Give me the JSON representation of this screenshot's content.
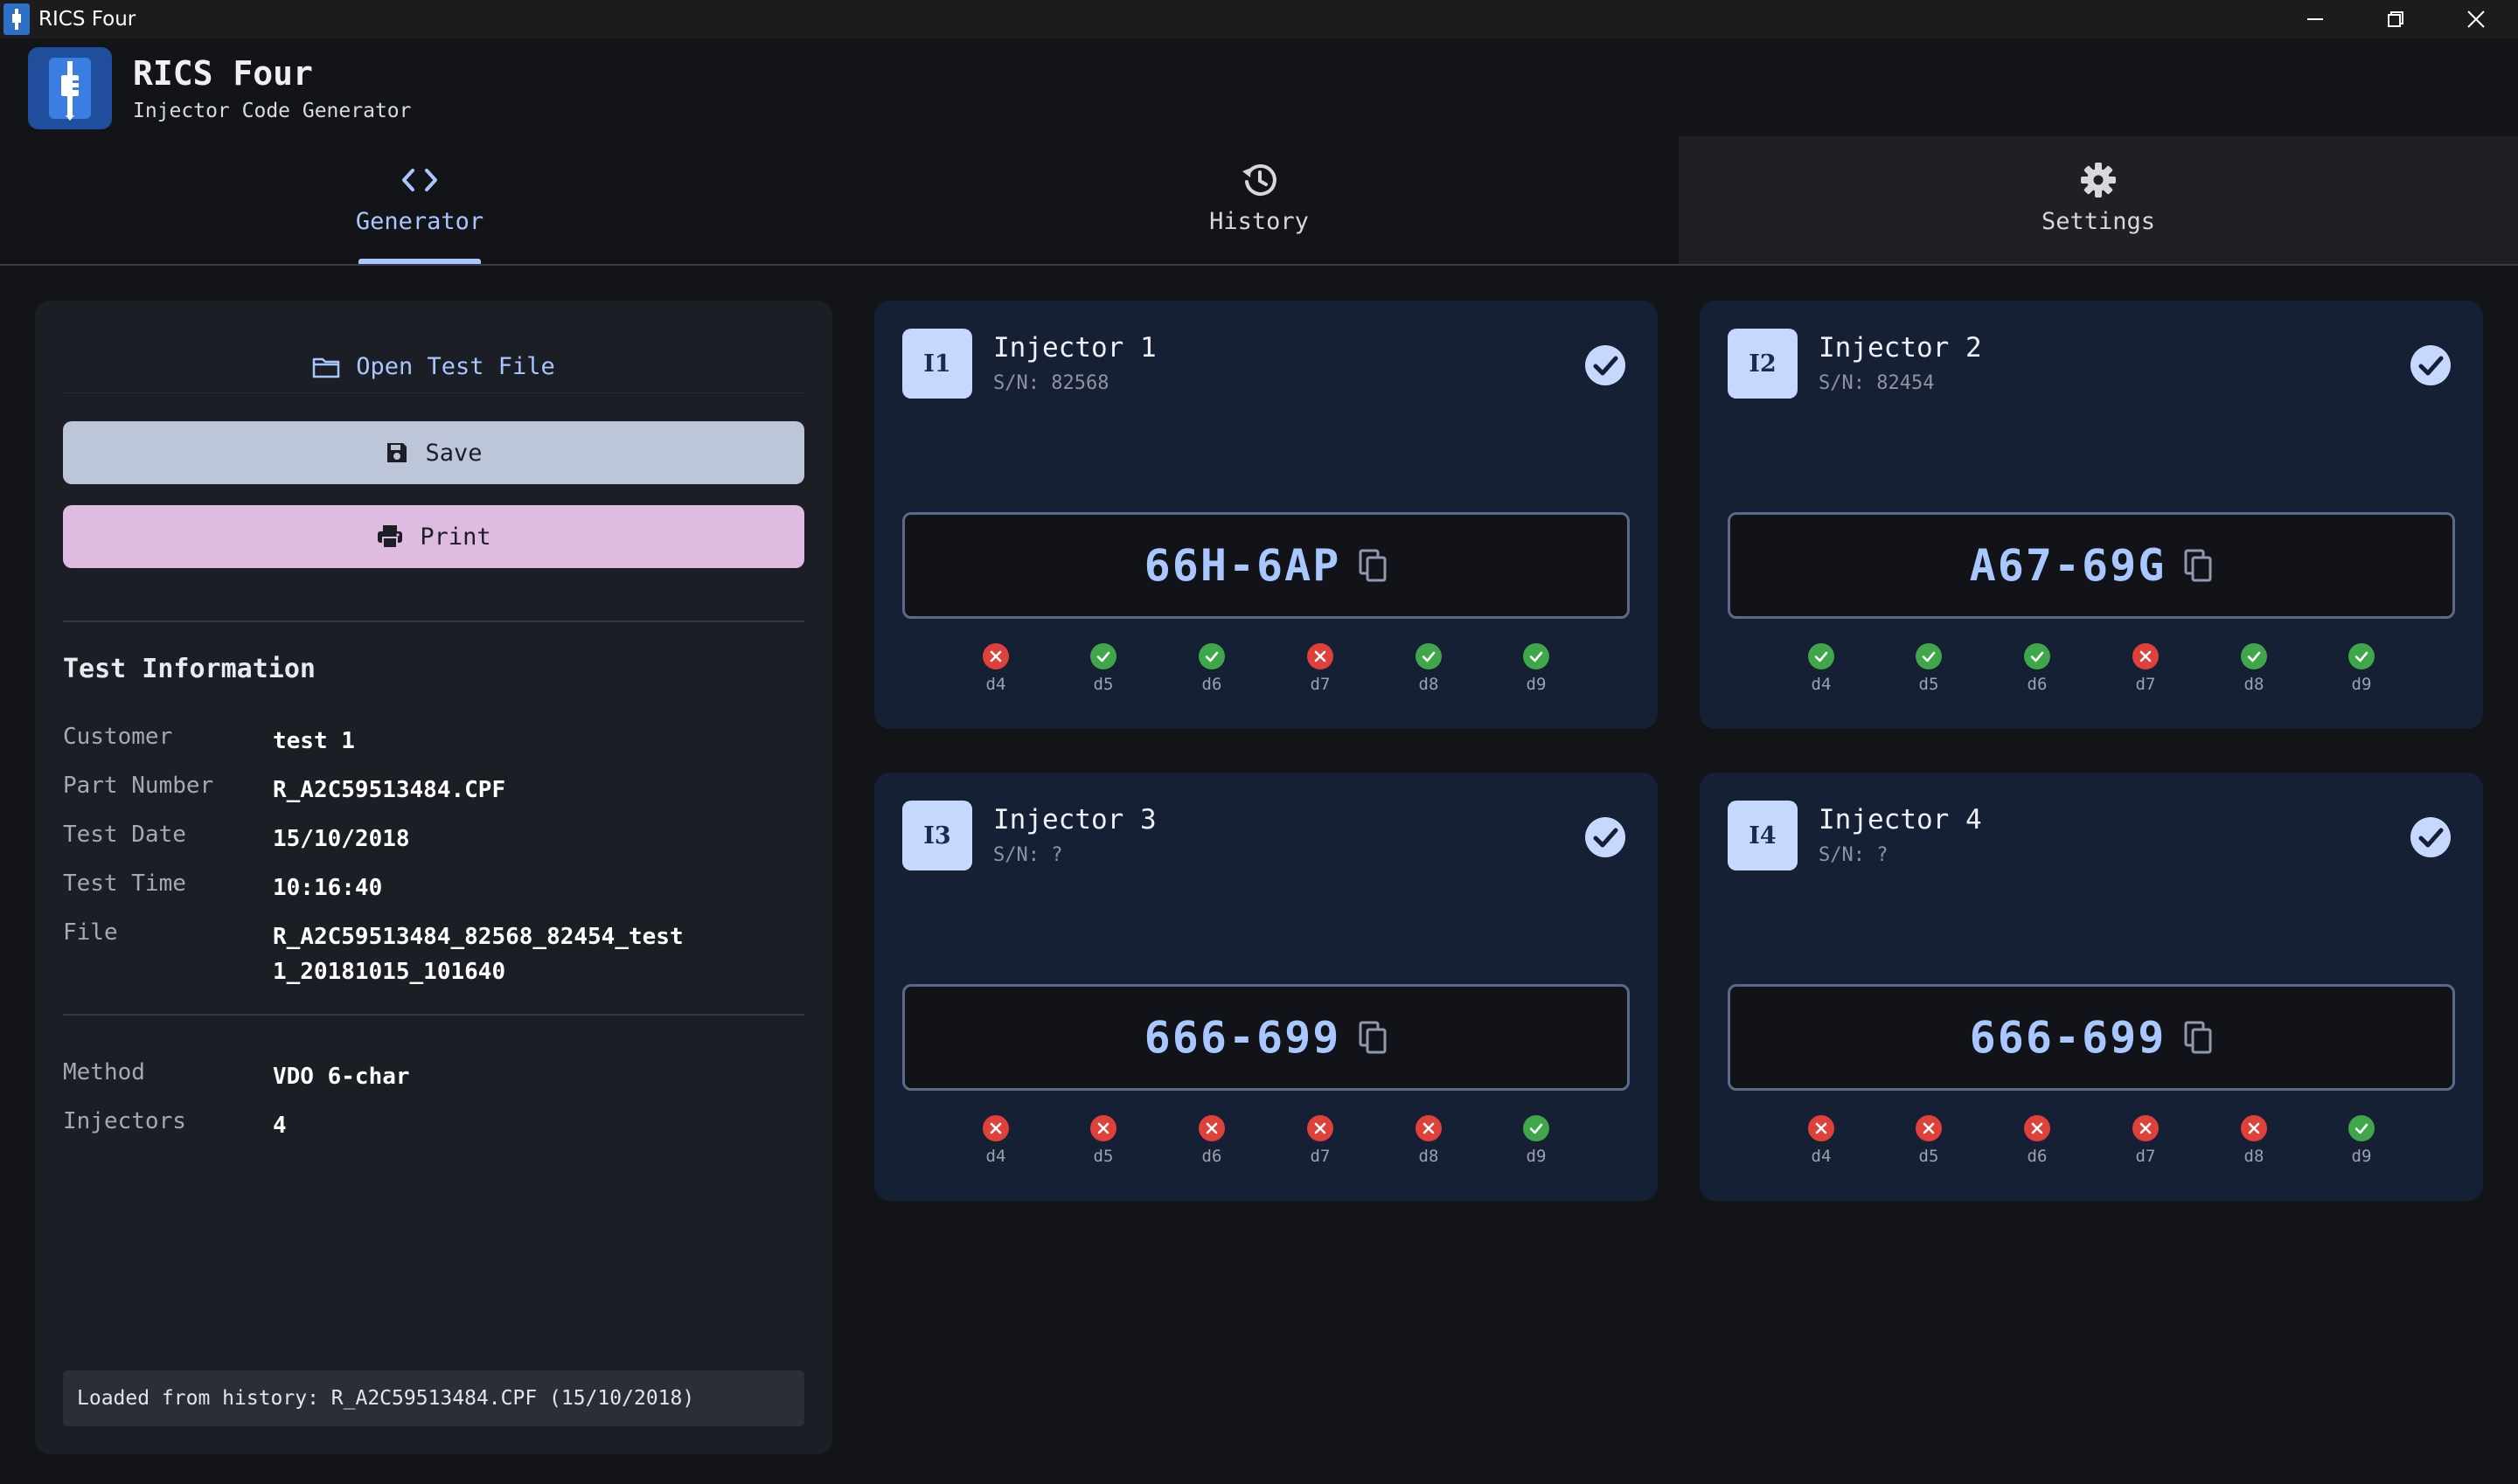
{
  "window": {
    "title": "RICS Four"
  },
  "app": {
    "name": "RICS Four",
    "subtitle": "Injector Code Generator"
  },
  "tabs": [
    {
      "label": "Generator",
      "icon": "code-icon",
      "active": true
    },
    {
      "label": "History",
      "icon": "history-icon",
      "active": false
    },
    {
      "label": "Settings",
      "icon": "gear-icon",
      "active": false
    }
  ],
  "actions": {
    "open_label": "Open Test File",
    "save_label": "Save",
    "print_label": "Print"
  },
  "test_info": {
    "title": "Test Information",
    "rows": [
      {
        "key": "Customer",
        "value": "test 1"
      },
      {
        "key": "Part Number",
        "value": "R_A2C59513484.CPF"
      },
      {
        "key": "Test Date",
        "value": "15/10/2018"
      },
      {
        "key": "Test Time",
        "value": "10:16:40"
      },
      {
        "key": "File",
        "value": "R_A2C59513484_82568_82454_test 1_20181015_101640"
      }
    ],
    "method": {
      "key": "Method",
      "value": "VDO 6-char"
    },
    "injectors": {
      "key": "Injectors",
      "value": "4"
    }
  },
  "status": "Loaded from history: R_A2C59513484.CPF (15/10/2018)",
  "injectors": [
    {
      "badge": "I1",
      "title": "Injector 1",
      "sn": "S/N: 82568",
      "code": "66H-6AP",
      "digits": [
        {
          "label": "d4",
          "ok": false
        },
        {
          "label": "d5",
          "ok": true
        },
        {
          "label": "d6",
          "ok": true
        },
        {
          "label": "d7",
          "ok": false
        },
        {
          "label": "d8",
          "ok": true
        },
        {
          "label": "d9",
          "ok": true
        }
      ]
    },
    {
      "badge": "I2",
      "title": "Injector 2",
      "sn": "S/N: 82454",
      "code": "A67-69G",
      "digits": [
        {
          "label": "d4",
          "ok": true
        },
        {
          "label": "d5",
          "ok": true
        },
        {
          "label": "d6",
          "ok": true
        },
        {
          "label": "d7",
          "ok": false
        },
        {
          "label": "d8",
          "ok": true
        },
        {
          "label": "d9",
          "ok": true
        }
      ]
    },
    {
      "badge": "I3",
      "title": "Injector 3",
      "sn": "S/N: ?",
      "code": "666-699",
      "digits": [
        {
          "label": "d4",
          "ok": false
        },
        {
          "label": "d5",
          "ok": false
        },
        {
          "label": "d6",
          "ok": false
        },
        {
          "label": "d7",
          "ok": false
        },
        {
          "label": "d8",
          "ok": false
        },
        {
          "label": "d9",
          "ok": true
        }
      ]
    },
    {
      "badge": "I4",
      "title": "Injector 4",
      "sn": "S/N: ?",
      "code": "666-699",
      "digits": [
        {
          "label": "d4",
          "ok": false
        },
        {
          "label": "d5",
          "ok": false
        },
        {
          "label": "d6",
          "ok": false
        },
        {
          "label": "d7",
          "ok": false
        },
        {
          "label": "d8",
          "ok": false
        },
        {
          "label": "d9",
          "ok": true
        }
      ]
    }
  ]
}
